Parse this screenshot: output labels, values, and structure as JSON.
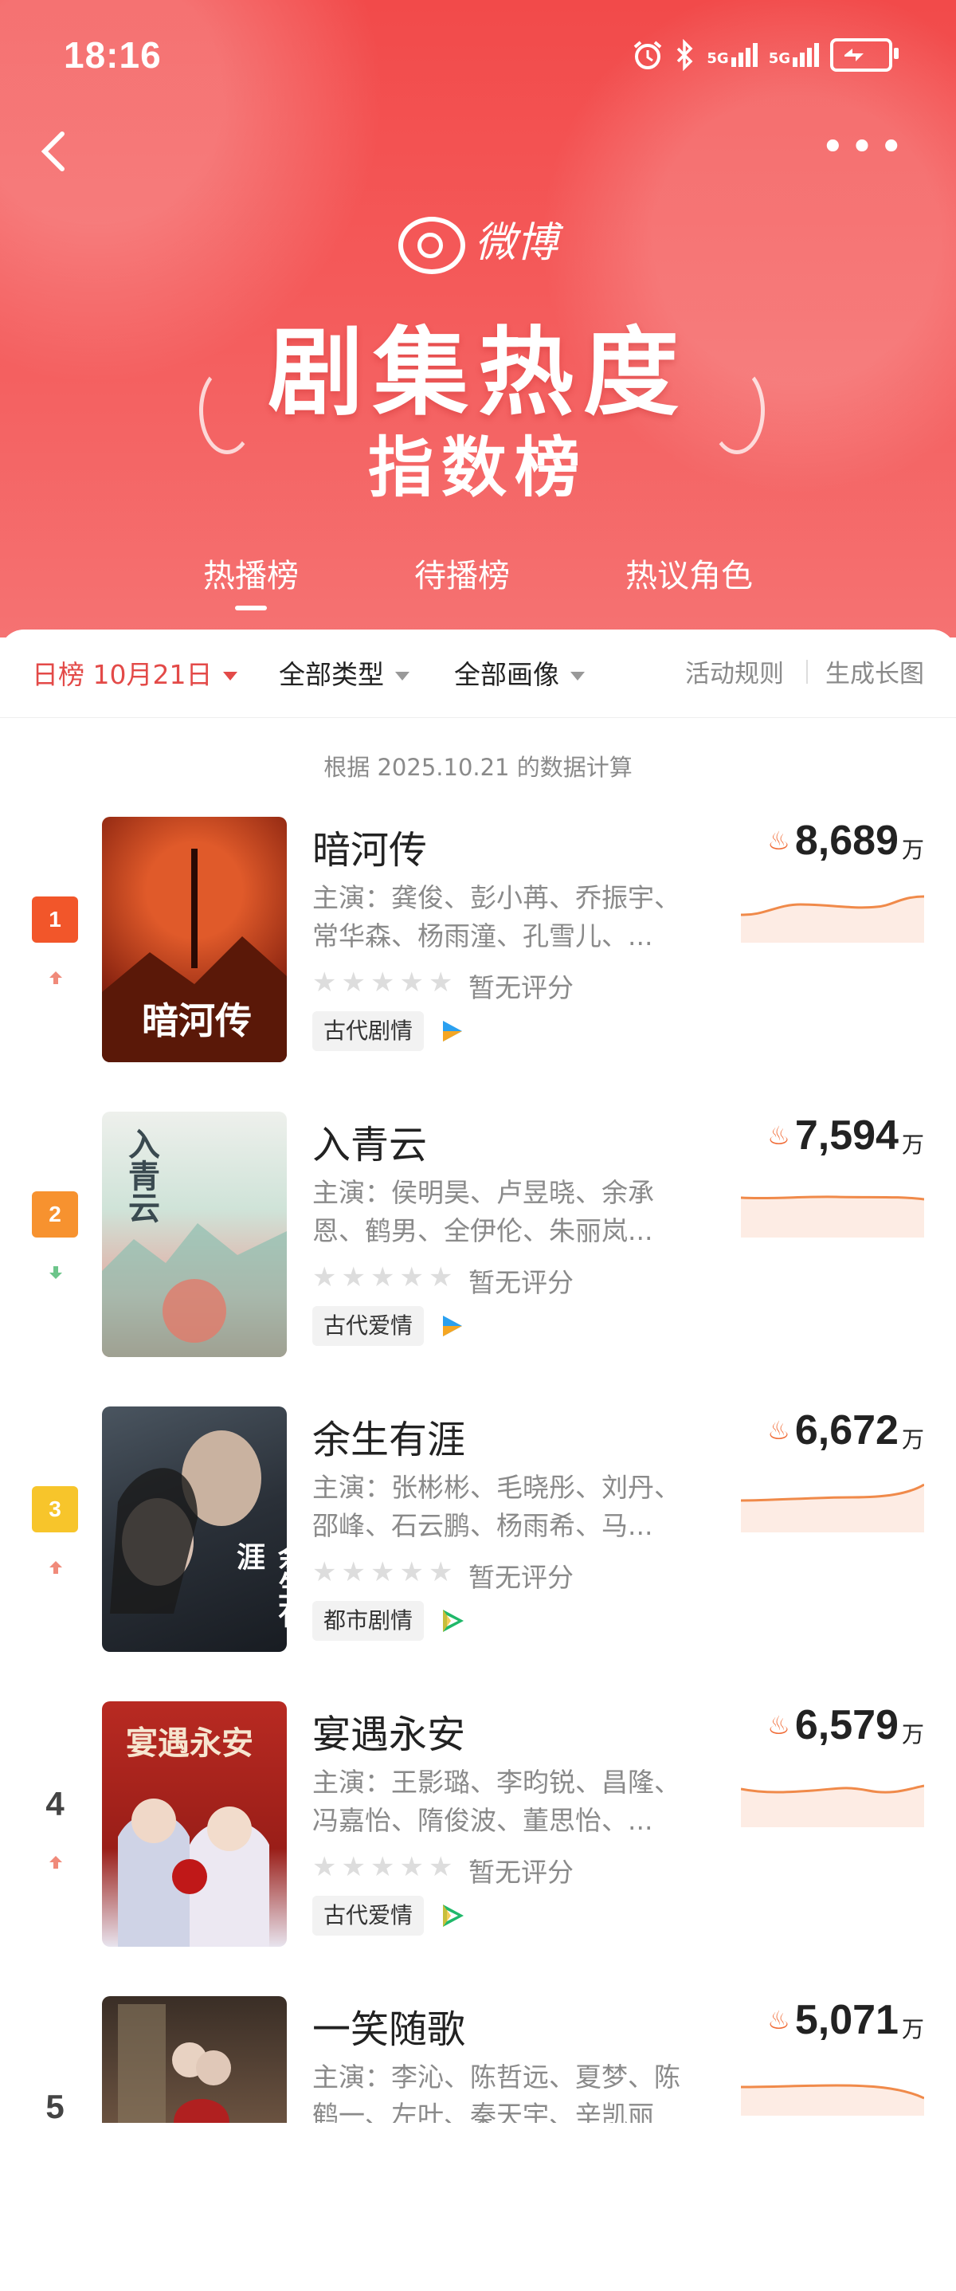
{
  "status_bar": {
    "time": "18:16",
    "net1": "5G",
    "net2": "5G"
  },
  "header": {
    "logo_text": "微博",
    "title_line1": "剧集热度",
    "title_line2": "指数榜",
    "tabs": [
      {
        "label": "热播榜",
        "active": true
      },
      {
        "label": "待播榜",
        "active": false
      },
      {
        "label": "热议角色",
        "active": false
      }
    ]
  },
  "filters": {
    "date": "日榜 10月21日",
    "type": "全部类型",
    "image": "全部画像",
    "rules": "活动规则",
    "long_image": "生成长图"
  },
  "data_note": "根据 2025.10.21 的数据计算",
  "colors": {
    "accent": "#e34a48",
    "rank1": "#f2562a",
    "rank2": "#f7922f",
    "rank3": "#f7c52b",
    "heat": "#f06a35"
  },
  "items": [
    {
      "rank": "1",
      "trend": "up",
      "title": "暗河传",
      "cast_line1": "主演：龚俊、彭小苒、乔振宇、",
      "cast_line2": "常华森、杨雨潼、孔雪儿、...",
      "rating": "暂无评分",
      "genre": "古代剧情",
      "heat": "8,689",
      "unit": "万",
      "poster_text": "暗河传",
      "platform": "youku-icon"
    },
    {
      "rank": "2",
      "trend": "down",
      "title": "入青云",
      "cast_line1": "主演：侯明昊、卢昱晓、余承",
      "cast_line2": "恩、鹤男、全伊伦、朱丽岚...",
      "rating": "暂无评分",
      "genre": "古代爱情",
      "heat": "7,594",
      "unit": "万",
      "poster_text": "入青云",
      "platform": "youku-icon"
    },
    {
      "rank": "3",
      "trend": "up",
      "title": "余生有涯",
      "cast_line1": "主演：张彬彬、毛晓彤、刘丹、",
      "cast_line2": "邵峰、石云鹏、杨雨希、马...",
      "rating": "暂无评分",
      "genre": "都市剧情",
      "heat": "6,672",
      "unit": "万",
      "poster_text": "余生有涯",
      "platform": "tencent-video-icon"
    },
    {
      "rank": "4",
      "trend": "up",
      "title": "宴遇永安",
      "cast_line1": "主演：王影璐、李昀锐、昌隆、",
      "cast_line2": "冯嘉怡、隋俊波、董思怡、...",
      "rating": "暂无评分",
      "genre": "古代爱情",
      "heat": "6,579",
      "unit": "万",
      "poster_text": "宴遇永安",
      "platform": "tencent-video-icon"
    },
    {
      "rank": "5",
      "trend": "up",
      "title": "一笑随歌",
      "cast_line1": "主演：李沁、陈哲远、夏梦、陈",
      "cast_line2": "鹤一、左叶、秦天宇、辛凯丽",
      "rating": "",
      "genre": "",
      "heat": "5,071",
      "unit": "万",
      "poster_text": "",
      "platform": ""
    }
  ]
}
